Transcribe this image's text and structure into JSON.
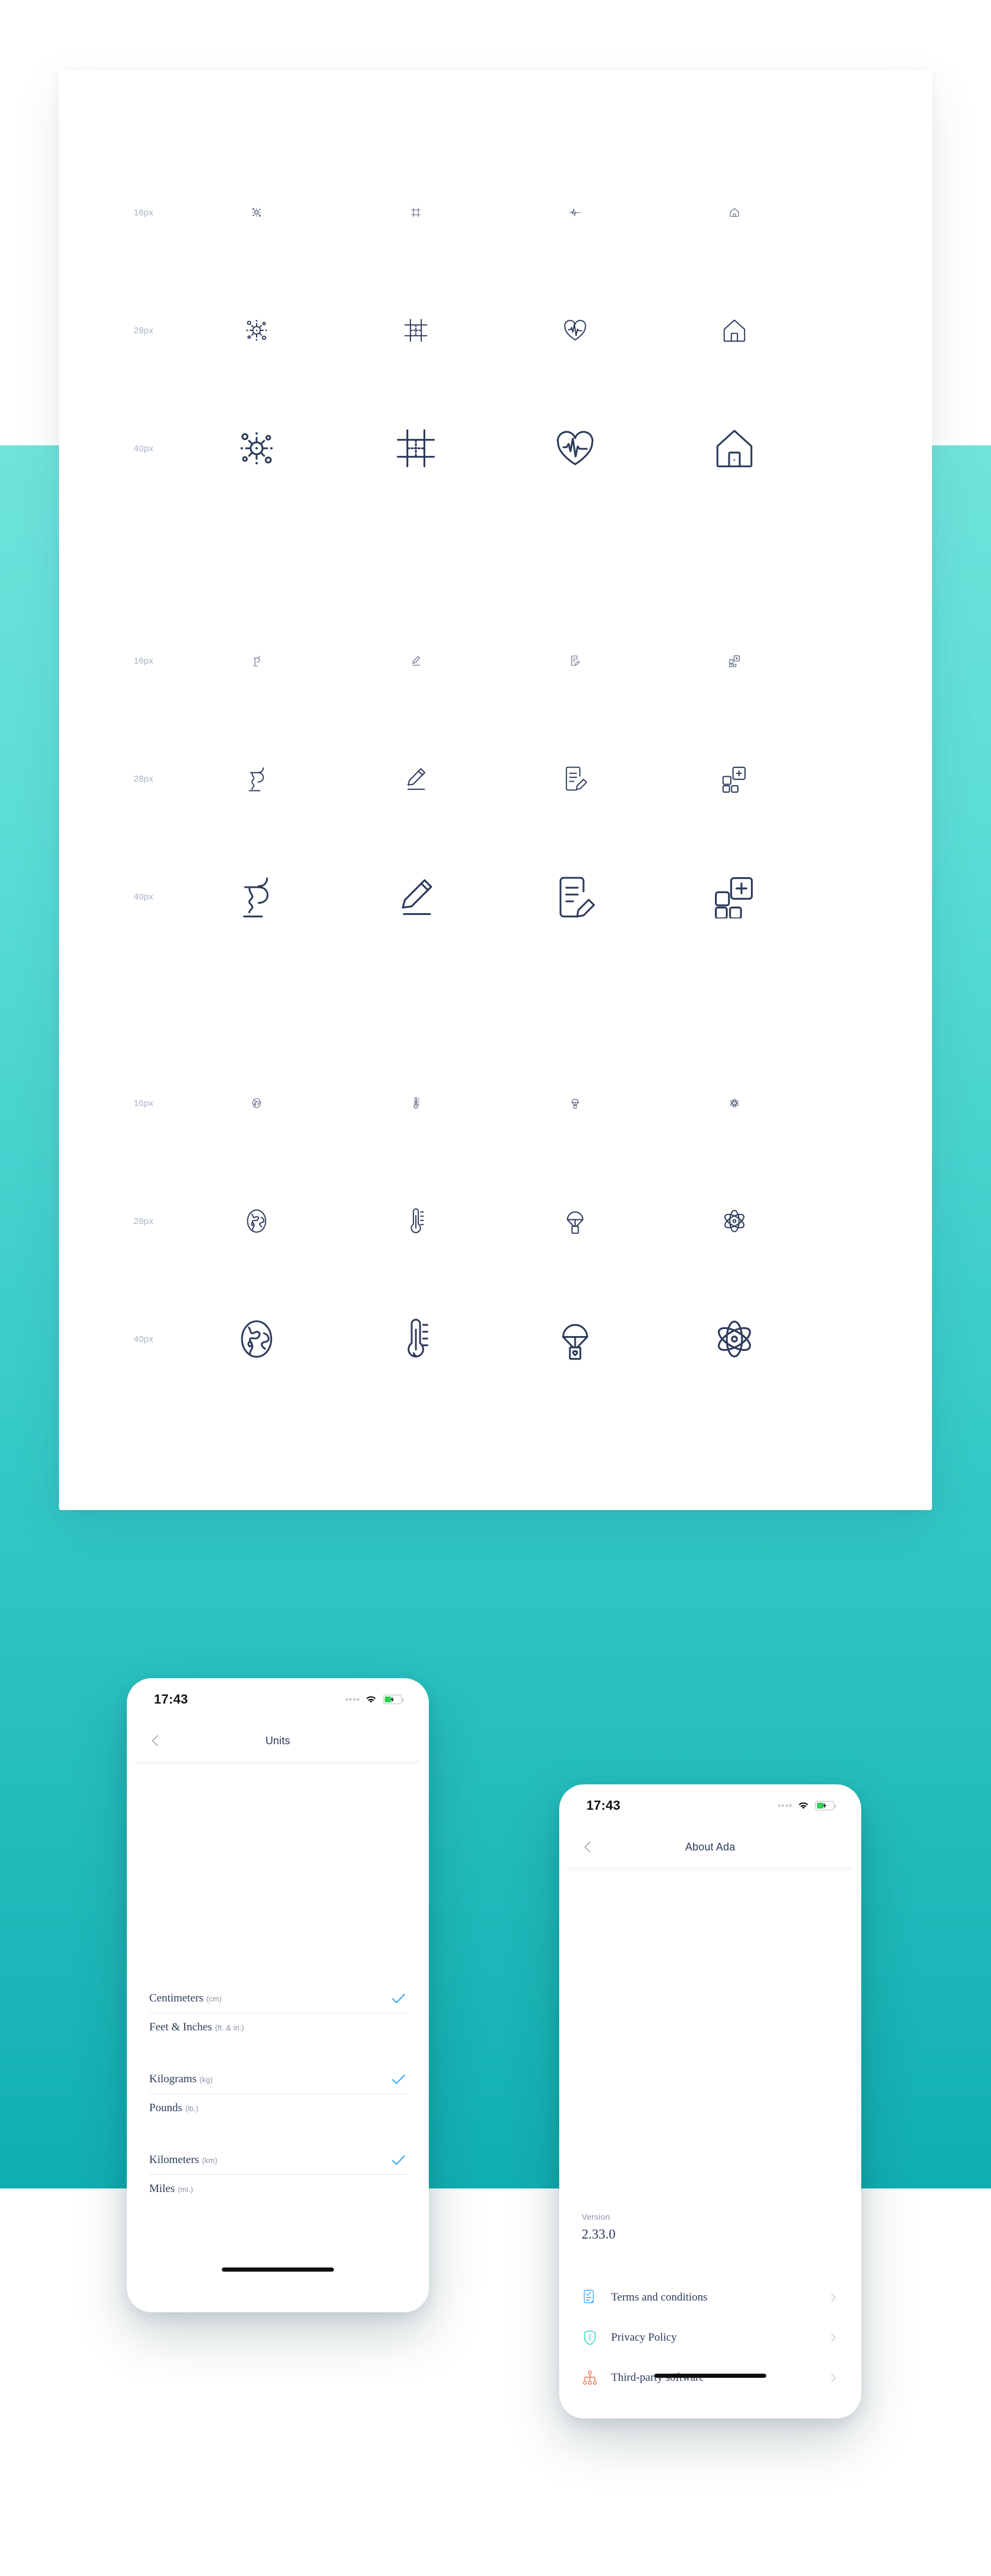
{
  "colors": {
    "teal_light": "#6FE3DB",
    "teal_dark": "#11AFB2",
    "ink": "#2C3A5A",
    "muted": "#8A93A5",
    "check_blue": "#3FA9F5",
    "shield_teal": "#1ED6C8",
    "tree_orange": "#F2764B",
    "doc_blue": "#3FA9F5",
    "battery_green": "#31D158"
  },
  "icon_sheet": {
    "sizes": [
      "16px",
      "28px",
      "40px"
    ],
    "groups": [
      {
        "id": "group-1",
        "icons": [
          {
            "name": "virus-icon",
            "label": "virus"
          },
          {
            "name": "crop-frame-icon",
            "label": "crop frame"
          },
          {
            "name": "pulse-icon",
            "label": "pulse"
          },
          {
            "name": "home-icon",
            "label": "home"
          }
        ],
        "variants": [
          [
            "virus-icon",
            "crop-frame-icon",
            "pulse-icon",
            "home-icon"
          ],
          [
            "virus-icon",
            "crop-frame-grid-icon",
            "heart-pulse-icon",
            "home-icon"
          ],
          [
            "virus-icon",
            "crop-frame-grid-icon",
            "heart-pulse-icon",
            "home-icon"
          ]
        ]
      },
      {
        "id": "group-2",
        "icons": [
          {
            "name": "pharmacy-icon",
            "label": "pharmacy"
          },
          {
            "name": "pencil-icon",
            "label": "pencil"
          },
          {
            "name": "document-edit-icon",
            "label": "document edit"
          },
          {
            "name": "grid-plus-icon",
            "label": "grid plus"
          }
        ]
      },
      {
        "id": "group-3",
        "icons": [
          {
            "name": "globe-icon",
            "label": "globe"
          },
          {
            "name": "thermometer-icon",
            "label": "thermometer"
          },
          {
            "name": "aid-parachute-icon",
            "label": "aid parachute"
          },
          {
            "name": "atom-icon",
            "label": "atom"
          }
        ]
      }
    ]
  },
  "phone_units": {
    "status": {
      "time": "17:43"
    },
    "nav": {
      "title": "Units",
      "back_icon": "chevron-left-icon"
    },
    "unit_groups": [
      {
        "rows": [
          {
            "label": "Centimeters",
            "abbr": "(cm)",
            "selected": true
          },
          {
            "label": "Feet & Inches",
            "abbr": "(ft. & in.)",
            "selected": false
          }
        ]
      },
      {
        "rows": [
          {
            "label": "Kilograms",
            "abbr": "(kg)",
            "selected": true
          },
          {
            "label": "Pounds",
            "abbr": "(lb.)",
            "selected": false
          }
        ]
      },
      {
        "rows": [
          {
            "label": "Kilometers",
            "abbr": "(km)",
            "selected": true
          },
          {
            "label": "Miles",
            "abbr": "(mi.)",
            "selected": false
          }
        ]
      }
    ]
  },
  "phone_about": {
    "status": {
      "time": "17:43"
    },
    "nav": {
      "title": "About Ada",
      "back_icon": "chevron-left-icon"
    },
    "version": {
      "caption": "Version",
      "value": "2.33.0"
    },
    "menu": [
      {
        "label": "Terms and conditions",
        "icon": "document-check-icon",
        "color": "#3FA9F5"
      },
      {
        "label": "Privacy Policy",
        "icon": "shield-icon",
        "color": "#1ED6C8"
      },
      {
        "label": "Third-party software",
        "icon": "hierarchy-icon",
        "color": "#F2764B"
      }
    ]
  }
}
